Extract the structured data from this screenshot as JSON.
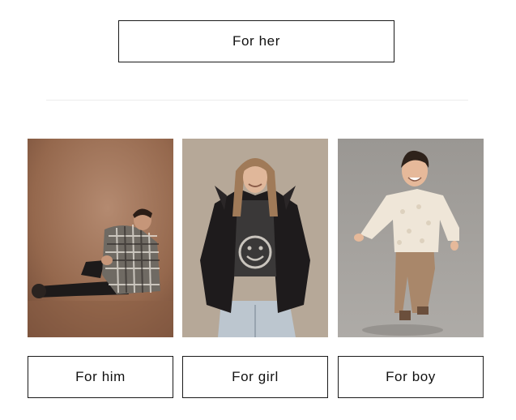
{
  "top_button": {
    "label": "For her"
  },
  "categories": [
    {
      "label": "For him",
      "image": "man-sitting-plaid-jacket"
    },
    {
      "label": "For girl",
      "image": "girl-leather-jacket-smiley-sweater"
    },
    {
      "label": "For boy",
      "image": "boy-cream-sweater-brown-pants"
    }
  ],
  "colors": {
    "border": "#1a1a1a",
    "divider": "#ececec",
    "background": "#ffffff"
  }
}
